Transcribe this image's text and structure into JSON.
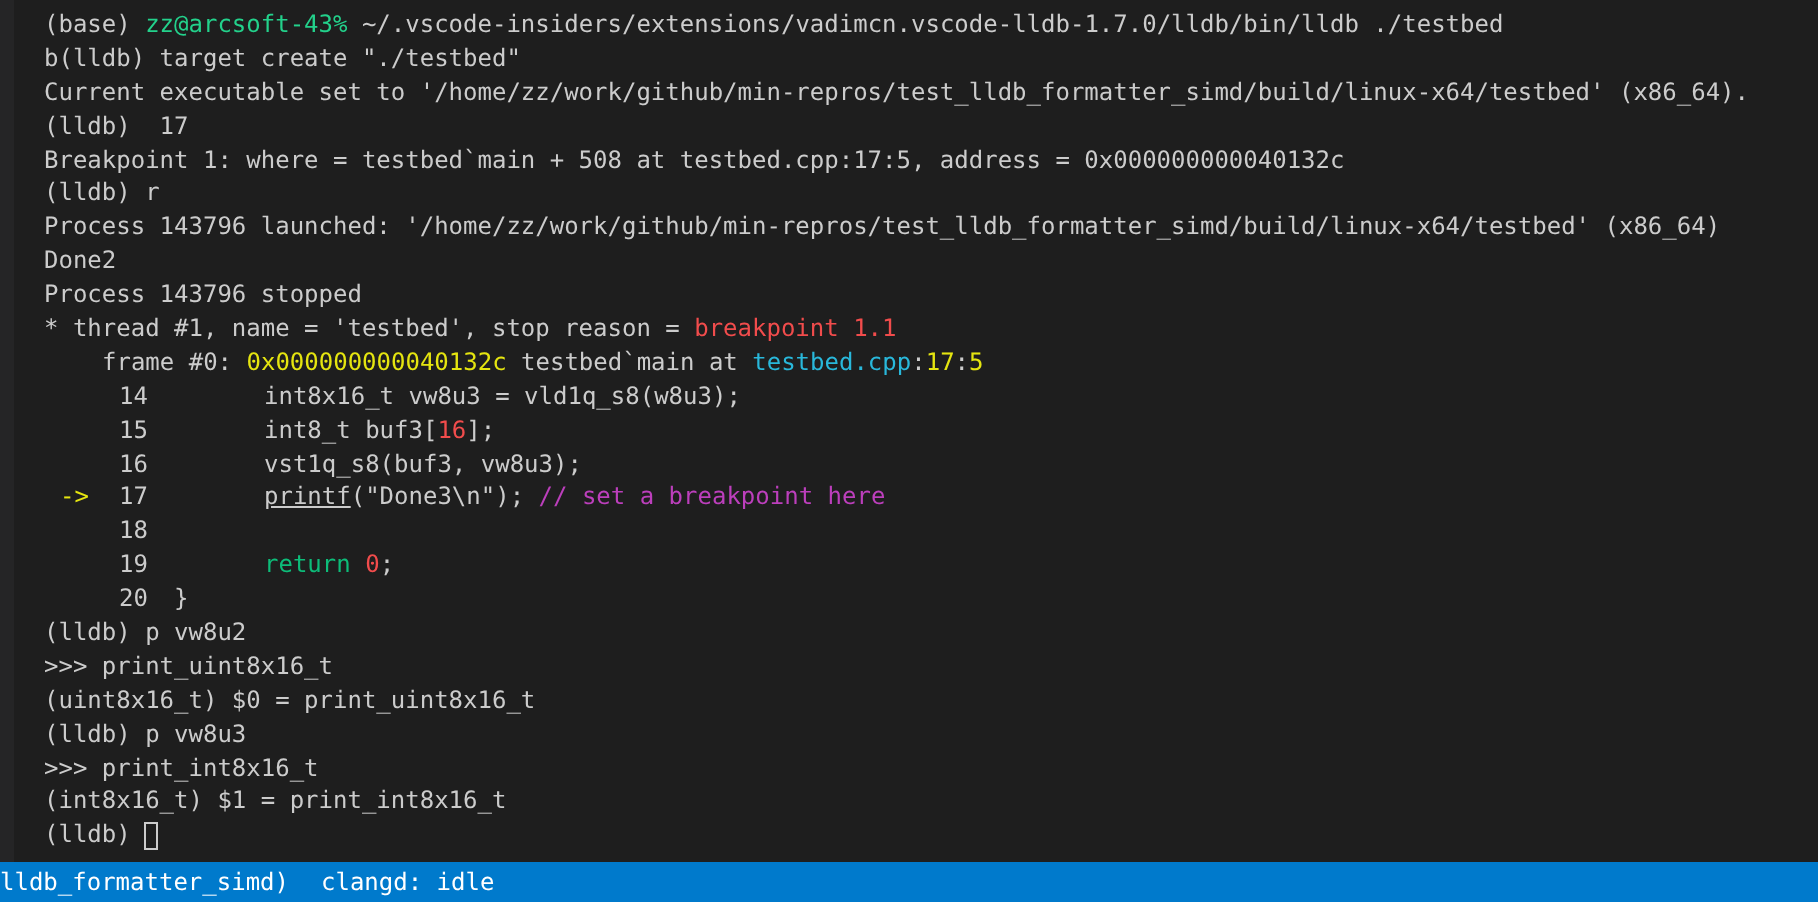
{
  "terminal": {
    "lines": [
      {
        "kind": "text",
        "segments": [
          {
            "text": "(base) "
          },
          {
            "text": "zz@arcsoft-43%",
            "color": "#23d18b"
          },
          {
            "text": " ~/.vscode-insiders/extensions/vadimcn.vscode-lldb-1.7.0/lldb/bin/lldb ./testbed"
          }
        ]
      },
      {
        "kind": "text",
        "segments": [
          {
            "text": "b(lldb) target create \"./testbed\""
          }
        ]
      },
      {
        "kind": "text",
        "segments": [
          {
            "text": "Current executable set to '/home/zz/work/github/min-repros/test_lldb_formatter_simd/build/linux-x64/testbed' (x86_64)."
          }
        ]
      },
      {
        "kind": "text",
        "segments": [
          {
            "text": "(lldb)  17"
          }
        ]
      },
      {
        "kind": "text",
        "segments": [
          {
            "text": "Breakpoint 1: where = testbed`main + 508 at testbed.cpp:17:5, address = 0x000000000040132c"
          }
        ]
      },
      {
        "kind": "text",
        "segments": [
          {
            "text": "(lldb) r"
          }
        ]
      },
      {
        "kind": "text",
        "segments": [
          {
            "text": "Process 143796 launched: '/home/zz/work/github/min-repros/test_lldb_formatter_simd/build/linux-x64/testbed' (x86_64)"
          }
        ]
      },
      {
        "kind": "text",
        "segments": [
          {
            "text": "Done2"
          }
        ]
      },
      {
        "kind": "text",
        "segments": [
          {
            "text": "Process 143796 stopped"
          }
        ]
      },
      {
        "kind": "text",
        "segments": [
          {
            "text": "* thread #1, name = 'testbed', stop reason = "
          },
          {
            "text": "breakpoint 1.1",
            "color": "#f14c4c"
          }
        ]
      },
      {
        "kind": "frame",
        "segments": [
          {
            "text": "frame #0: "
          },
          {
            "text": "0x000000000040132c",
            "color": "#e5e510"
          },
          {
            "text": " testbed`main at "
          },
          {
            "text": "testbed.cpp",
            "color": "#29b8db"
          },
          {
            "text": ":"
          },
          {
            "text": "17",
            "color": "#e5e510"
          },
          {
            "text": ":"
          },
          {
            "text": "5",
            "color": "#e5e510"
          }
        ]
      },
      {
        "kind": "source",
        "number": "14",
        "segments": [
          {
            "text": "int8x16_t vw8u3 = vld1q_s8(w8u3);"
          }
        ]
      },
      {
        "kind": "source",
        "number": "15",
        "segments": [
          {
            "text": "int8_t buf3["
          },
          {
            "text": "16",
            "color": "#f14c4c"
          },
          {
            "text": "];"
          }
        ]
      },
      {
        "kind": "source",
        "number": "16",
        "segments": [
          {
            "text": "vst1q_s8(buf3, vw8u3);"
          }
        ]
      },
      {
        "kind": "source",
        "number": "17",
        "marker": "->",
        "segments": [
          {
            "text": "printf",
            "underline": true
          },
          {
            "text": "(\"Done3\\n\"); "
          },
          {
            "text": "// set a breakpoint here",
            "color": "#bc3fbc"
          }
        ]
      },
      {
        "kind": "source",
        "number": "18"
      },
      {
        "kind": "source",
        "number": "19",
        "segments": [
          {
            "text": "return ",
            "color": "#0dbc79"
          },
          {
            "text": "0",
            "color": "#f14c4c"
          },
          {
            "text": ";"
          }
        ]
      },
      {
        "kind": "source-end",
        "number": "20",
        "segments": [
          {
            "text": "}"
          }
        ]
      },
      {
        "kind": "text",
        "segments": [
          {
            "text": "(lldb) p vw8u2"
          }
        ]
      },
      {
        "kind": "text",
        "segments": [
          {
            "text": ">>> print_uint8x16_t"
          }
        ]
      },
      {
        "kind": "text",
        "segments": [
          {
            "text": "(uint8x16_t) $0 = print_uint8x16_t"
          }
        ]
      },
      {
        "kind": "text",
        "segments": [
          {
            "text": "(lldb) p vw8u3"
          }
        ]
      },
      {
        "kind": "text",
        "segments": [
          {
            "text": ">>> print_int8x16_t"
          }
        ]
      },
      {
        "kind": "text",
        "segments": [
          {
            "text": "(int8x16_t) $1 = print_int8x16_t"
          }
        ]
      },
      {
        "kind": "prompt",
        "segments": [
          {
            "text": "(lldb)"
          }
        ]
      }
    ]
  },
  "status_bar": {
    "items": [
      "lldb_formatter_simd)",
      "clangd: idle"
    ]
  }
}
